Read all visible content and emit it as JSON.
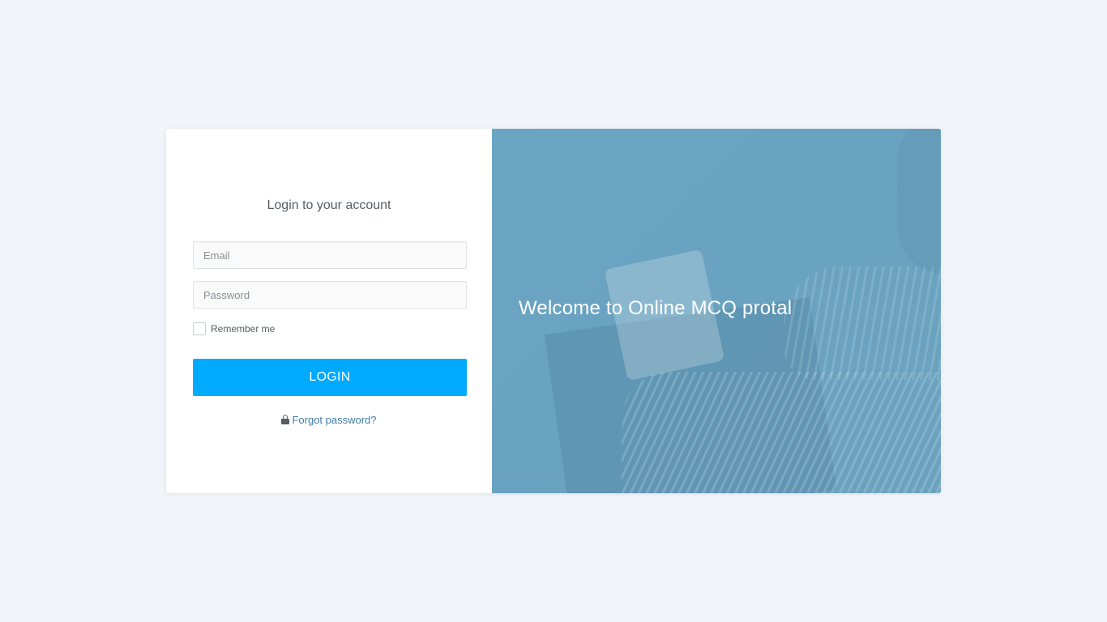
{
  "login": {
    "title": "Login to your account",
    "email_placeholder": "Email",
    "password_placeholder": "Password",
    "remember_label": "Remember me",
    "remember_checked": false,
    "button_label": "LOGIN",
    "forgot_label": "Forgot password?"
  },
  "welcome": {
    "text": "Welcome to Online MCQ protal"
  },
  "colors": {
    "page_background": "#f1f4f8",
    "accent": "#00aaff",
    "link": "#3e7ba8",
    "welcome_overlay": "#6aa5c3"
  },
  "icons": {
    "forgot": "lock-icon"
  }
}
